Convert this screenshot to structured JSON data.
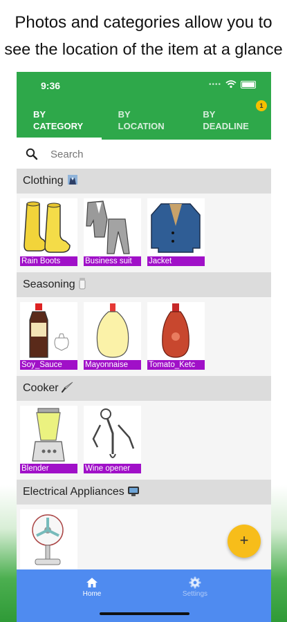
{
  "promo": {
    "line1": "Photos and categories allow you to",
    "line2": "see the location of the item at a glance"
  },
  "status_bar": {
    "time": "9:36"
  },
  "tabs": [
    {
      "line1": "BY",
      "line2": "CATEGORY",
      "active": true
    },
    {
      "line1": "BY",
      "line2": "LOCATION",
      "active": false
    },
    {
      "line1": "BY",
      "line2": "DEADLINE",
      "active": false,
      "badge": "1"
    }
  ],
  "search": {
    "placeholder": "Search"
  },
  "sections": [
    {
      "title": "Clothing",
      "icon": "suit-icon",
      "items": [
        "Rain Boots",
        "Business suit",
        "Jacket"
      ]
    },
    {
      "title": "Seasoning",
      "icon": "salt-shaker-icon",
      "items": [
        "Soy_Sauce",
        "Mayonnaise",
        "Tomato_Ketc"
      ]
    },
    {
      "title": "Cooker",
      "icon": "knife-icon",
      "items": [
        "Blender",
        "Wine opener"
      ]
    },
    {
      "title": "Electrical Appliances",
      "icon": "tv-icon",
      "items": [
        "Electric fan"
      ]
    }
  ],
  "fab": {
    "label": "+"
  },
  "bottom_nav": [
    {
      "label": "Home",
      "icon": "home-icon",
      "active": true
    },
    {
      "label": "Settings",
      "icon": "gear-icon",
      "active": false
    }
  ],
  "colors": {
    "app_bar": "#2ea84a",
    "item_label": "#a010c8",
    "fab": "#f7bd1a",
    "bottom_nav": "#4f8bf0"
  }
}
